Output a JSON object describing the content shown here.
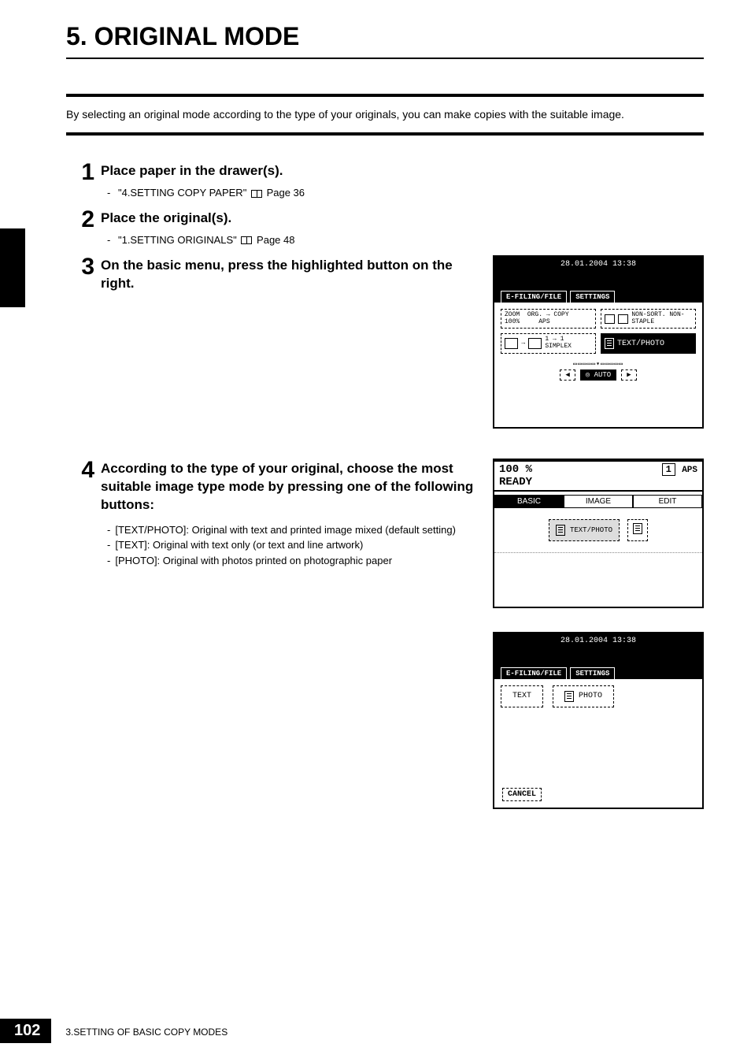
{
  "header": {
    "title": "5. ORIGINAL MODE"
  },
  "intro": "By selecting an original mode according to the type of your originals, you can make copies with the suitable image.",
  "steps": {
    "s1": {
      "num": "1",
      "heading": "Place paper in the drawer(s).",
      "ref_label": "\"4.SETTING COPY PAPER\"",
      "ref_page": "Page 36"
    },
    "s2": {
      "num": "2",
      "heading": "Place the original(s).",
      "ref_label": "\"1.SETTING ORIGINALS\"",
      "ref_page": "Page 48"
    },
    "s3": {
      "num": "3",
      "heading": "On the basic menu, press the highlighted button on the right."
    },
    "s4": {
      "num": "4",
      "heading": "According to the type of your original, choose the most suitable image type mode by pressing one of the following buttons:",
      "bullets": [
        "[TEXT/PHOTO]: Original with text and printed image mixed (default setting)",
        "[TEXT]: Original with text only (or text and line artwork)",
        "[PHOTO]: Original with photos printed on photographic paper"
      ]
    }
  },
  "scr1": {
    "timestamp": "28.01.2004 13:38",
    "tab1": "E-FILING/FILE",
    "tab2": "SETTINGS",
    "zoom_label": "ZOOM",
    "zoom_val": "100%",
    "org_copy": "ORG. → COPY",
    "aps": "APS",
    "sort": "NON-SORT. NON-STAPLE",
    "simplex": "1 → 1 SIMPLEX",
    "textphoto": "TEXT/PHOTO",
    "auto": "AUTO",
    "arrow_left": "◀",
    "arrow_right": "▶"
  },
  "scr2": {
    "pct": "100 %",
    "count": "1",
    "aps": "APS",
    "ready": "READY",
    "tab_basic": "BASIC",
    "tab_image": "IMAGE",
    "tab_edit": "EDIT",
    "textphoto": "TEXT/PHOTO"
  },
  "scr3": {
    "timestamp": "28.01.2004 13:38",
    "tab1": "E-FILING/FILE",
    "tab2": "SETTINGS",
    "text": "TEXT",
    "photo": "PHOTO",
    "cancel": "CANCEL"
  },
  "footer": {
    "page": "102",
    "chapter": "3.SETTING OF BASIC COPY MODES"
  }
}
